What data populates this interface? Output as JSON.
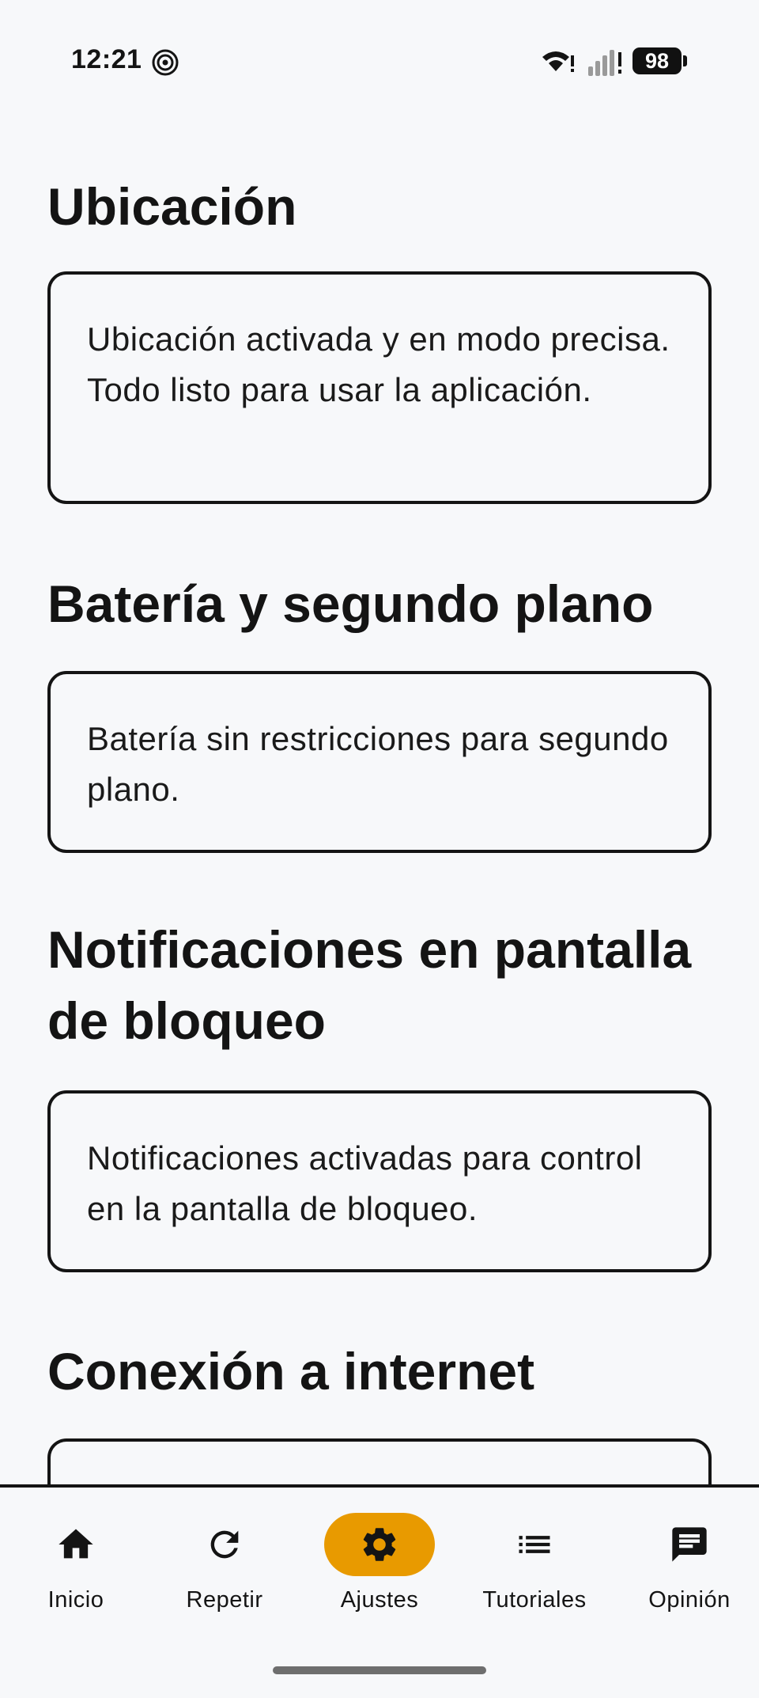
{
  "status_bar": {
    "time": "12:21",
    "battery": "98",
    "icons": [
      "focus-icon",
      "wifi-icon",
      "signal-icon",
      "battery-icon"
    ]
  },
  "sections": [
    {
      "title": "Ubicación",
      "text": "Ubicación activada y en modo precisa. Todo listo para usar la aplicación."
    },
    {
      "title": "Batería y segundo plano",
      "text": "Batería sin restricciones para segundo plano."
    },
    {
      "title": "Notificaciones en pantalla de bloqueo",
      "text": "Notificaciones activadas para control en la pantalla de bloqueo."
    },
    {
      "title": "Conexión a internet",
      "text": ""
    }
  ],
  "bottom_nav": {
    "items": [
      {
        "label": "Inicio",
        "icon": "home-icon"
      },
      {
        "label": "Repetir",
        "icon": "refresh-icon"
      },
      {
        "label": "Ajustes",
        "icon": "gear-icon",
        "active": true
      },
      {
        "label": "Tutoriales",
        "icon": "list-icon"
      },
      {
        "label": "Opinión",
        "icon": "feedback-icon"
      }
    ],
    "active_color": "#e89a00"
  }
}
